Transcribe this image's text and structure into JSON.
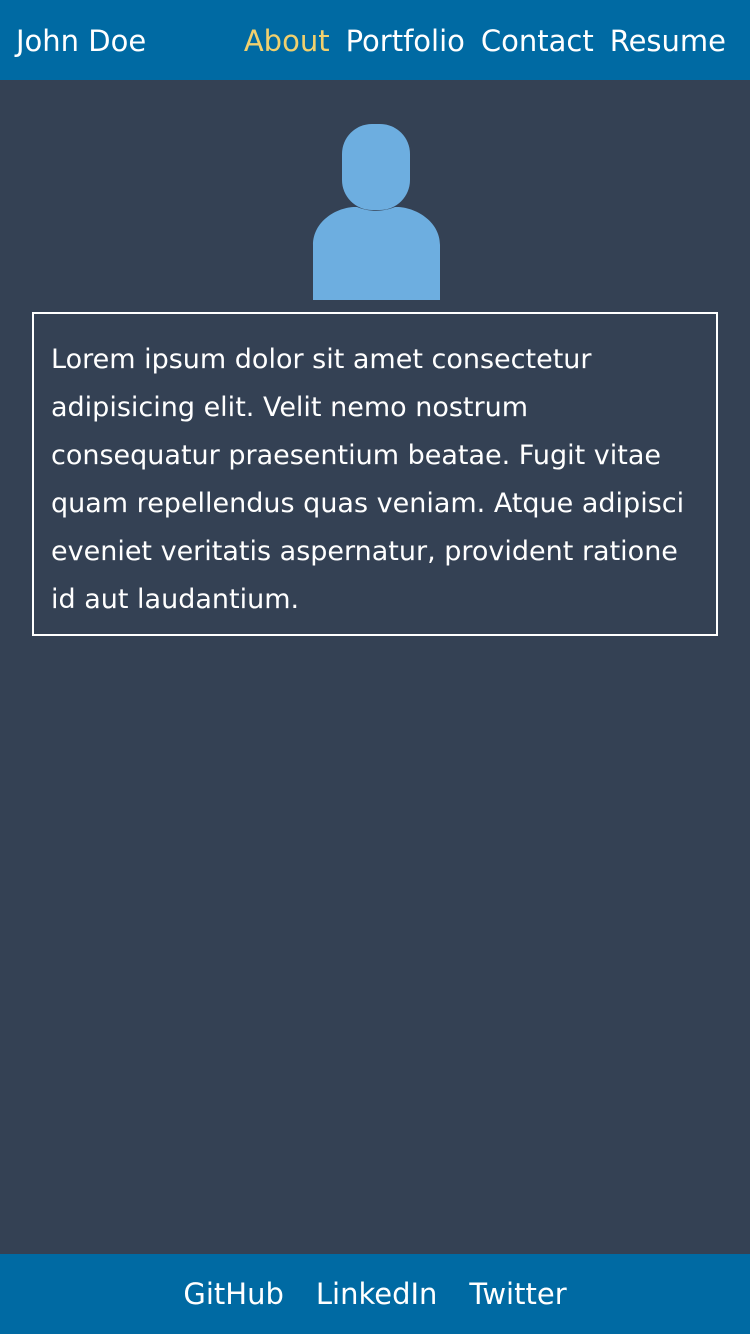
{
  "header": {
    "brand": "John Doe",
    "nav": [
      {
        "label": "About",
        "active": true
      },
      {
        "label": "Portfolio",
        "active": false
      },
      {
        "label": "Contact",
        "active": false
      },
      {
        "label": "Resume",
        "active": false
      }
    ]
  },
  "profile": {
    "avatar_icon": "user-silhouette-icon",
    "avatar_color": "#6daee0"
  },
  "about": {
    "text": "Lorem ipsum dolor sit amet consectetur adipisicing elit. Velit nemo nostrum consequatur praesentium beatae. Fugit vitae quam repellendus quas veniam. Atque adipisci eveniet veritatis aspernatur, provident ratione id aut laudantium."
  },
  "footer": {
    "links": [
      "GitHub",
      "LinkedIn",
      "Twitter"
    ]
  },
  "colors": {
    "background": "#344154",
    "bar": "#006aa3",
    "active": "#f0d06e",
    "text": "#ffffff"
  }
}
